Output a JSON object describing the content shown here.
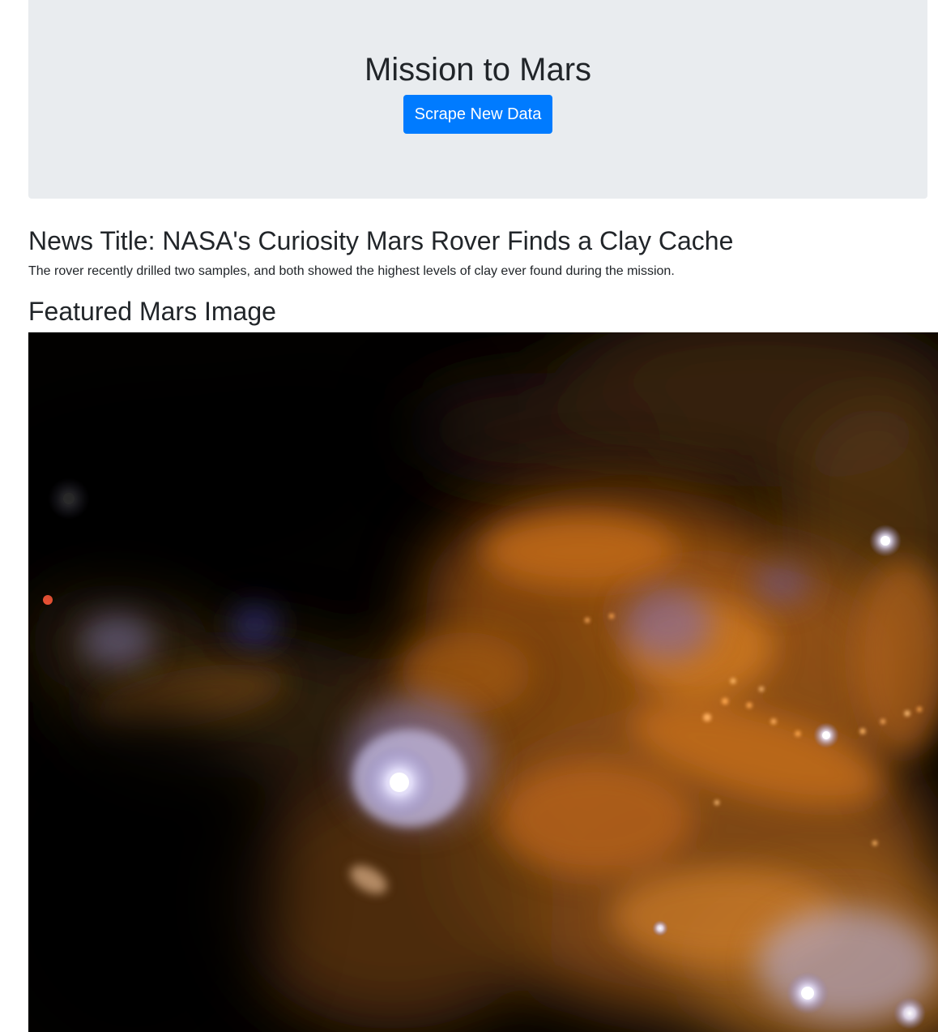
{
  "header": {
    "title": "Mission to Mars",
    "scrape_button_label": "Scrape New Data"
  },
  "news": {
    "title": "News Title: NASA's Curiosity Mars Rover Finds a Clay Cache",
    "teaser": "The rover recently drilled two samples, and both showed the highest levels of clay ever found during the mission."
  },
  "featured": {
    "heading": "Featured Mars Image",
    "image_description": "nebula-space-image"
  },
  "colors": {
    "jumbotron_bg": "#e9ecef",
    "primary_button": "#007bff",
    "text": "#212529"
  }
}
